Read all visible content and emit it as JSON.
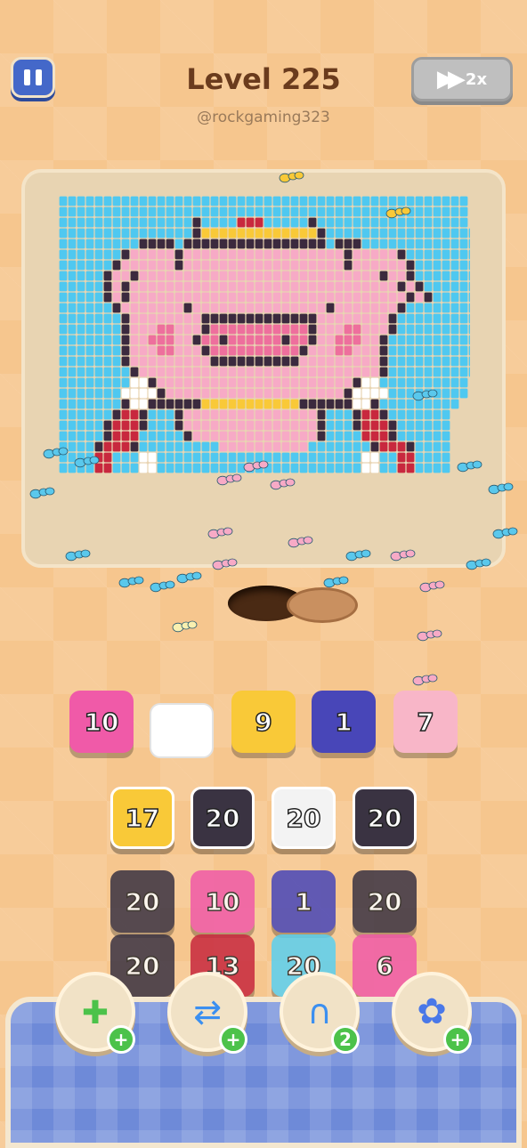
{
  "header": {
    "level_title": "Level 225",
    "username": "@rockgaming323",
    "speed_label": "2x"
  },
  "icons": {
    "pause": "pause-icon",
    "fast_forward": "fast-forward-icon"
  },
  "colors": {
    "pink": "#f05aa8",
    "light_pink": "#f8b6c8",
    "yellow": "#f9c938",
    "navy": "#4846b8",
    "dark": "#3a3342",
    "white": "#f3f3f3",
    "red": "#c8283e",
    "cyan": "#5ad0f0",
    "sky": "#4fc8f0"
  },
  "collect_slots": [
    {
      "value": "10",
      "color": "pink"
    },
    {
      "value": "",
      "color": "white_empty"
    },
    {
      "value": "9",
      "color": "yellow"
    },
    {
      "value": "1",
      "color": "navy"
    },
    {
      "value": "7",
      "color": "light_pink"
    }
  ],
  "tile_grid": [
    [
      {
        "value": "17",
        "color": "yellow"
      },
      {
        "value": "20",
        "color": "dark"
      },
      {
        "value": "20",
        "color": "white"
      },
      {
        "value": "20",
        "color": "dark"
      }
    ],
    [
      {
        "value": "20",
        "color": "dark"
      },
      {
        "value": "10",
        "color": "pink"
      },
      {
        "value": "1",
        "color": "navy"
      },
      {
        "value": "20",
        "color": "dark"
      }
    ],
    [
      {
        "value": "20",
        "color": "dark"
      },
      {
        "value": "13",
        "color": "red"
      },
      {
        "value": "20",
        "color": "cyan"
      },
      {
        "value": "6",
        "color": "pink"
      }
    ]
  ],
  "boosters": [
    {
      "name": "add-slot",
      "icon": "add-box-icon",
      "badge": "+"
    },
    {
      "name": "shuffle",
      "icon": "shuffle-icon",
      "badge": "+"
    },
    {
      "name": "magnet",
      "icon": "magnet-icon",
      "badge": "2"
    },
    {
      "name": "flower",
      "icon": "flower-icon",
      "badge": "+"
    }
  ],
  "pixel_art": {
    "subject": "pig-king",
    "rows": [
      "ssssssssssssssssssssssssssssssssssssssssssssss",
      "ssssssssssssssssssssssssssssssssssssssssssssss",
      "sssssssssssssssdssssrrrsssssdsssssssssssssssss",
      "sssssssssssssssdyyyyyyyyyyyyydsssssssssssssssss",
      "sssssssssddddsddddddddddddddddsdddsssssssssssss",
      "sssssssdpppppdppppppppppppppppppdpppppdsssssssss",
      "ssssssdppppppdppppppppppppppppppdppppppdssssssss",
      "sssssdppdpppppppppppppppppppppppppppdppdssssssss",
      "sssssdpdppppppppppppppppppppppppppppppdpdsssssss",
      "sssssdpdpppppppppppppppppppppppppppppppdpdssssss",
      "ssssssdpppppppdpppppppppppppppdpppppppdsssssssss",
      "sssssssdppppppppdddddddddddddppppppppdssssssssss",
      "sssssssdpppmmpppdmmmmmmmmmmmdpppmmpppdssssssssss",
      "sssssssdppmmmppdmmdmmmmmmdmmdppmmmppdsssssssssss",
      "sssssssdpppmmpppdmmmmmmmmmmdpppmmpppdsssssssssss",
      "sssssssdpppppppppddddddddddpppppppppdsssssssssss",
      "ssssssssdpppppppppppppppppppppppppppdssssssssss",
      "sssssssswwdppppppppppppppppppppppdwwssssssssss",
      "ssssssswwwwdppppppppppppppppppppdwwwwsssssssss",
      "sssssssdwwddddddyyyyyyyyyyyddddddwwdsssssssss",
      "ssssssdrrdsssdpppppppppppppppdsssdrrdsssssss",
      "sssssdrrrdsssdpppppppppppppppdsssdrrrdssssss",
      "sssssdrrrsssssdppppppppppppppdssssrrrdssssss",
      "ssssdrrrdsssssssssppppppppppsssssssdrrrdssss",
      "ssssrrssswwssssssssssssssssssssssswwssrrssss",
      "ssssrrssswwssssssssssssssssssssssswwssrrssss"
    ]
  }
}
